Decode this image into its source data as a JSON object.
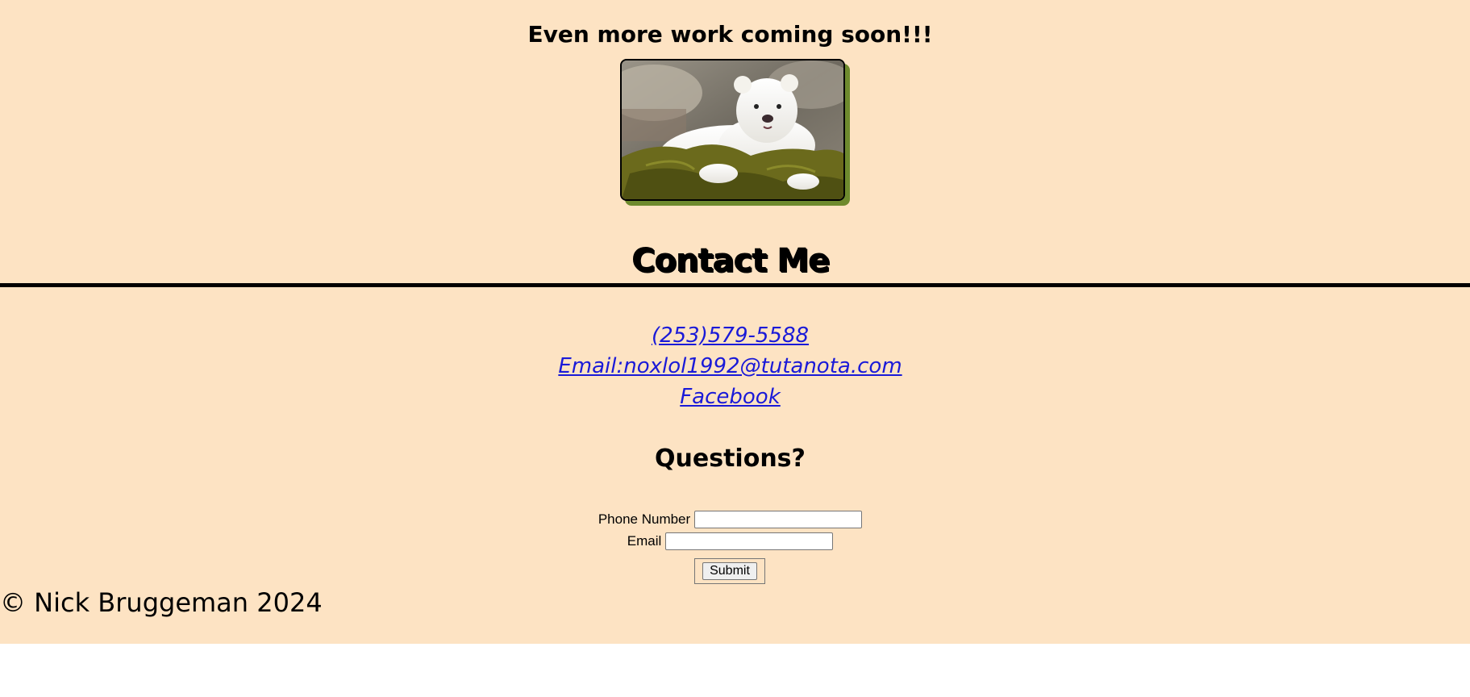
{
  "header": {
    "coming_soon": "Even more work coming soon!!!"
  },
  "photo": {
    "subject": "polar-bear-cub",
    "shadow_color": "#6e8a2e"
  },
  "contact": {
    "title": "Contact Me",
    "phone_link": "(253)579-5588",
    "email_link": "Email:noxlol1992@tutanota.com",
    "facebook_link": "Facebook"
  },
  "questions": {
    "title": "Questions?",
    "phone_label": "Phone Number",
    "phone_value": "",
    "email_label": "Email",
    "email_value": "",
    "submit_label": "Submit"
  },
  "footer": {
    "copyright": "© Nick Bruggeman 2024"
  },
  "colors": {
    "background": "#fde3c3",
    "link": "#1a1ad8"
  }
}
